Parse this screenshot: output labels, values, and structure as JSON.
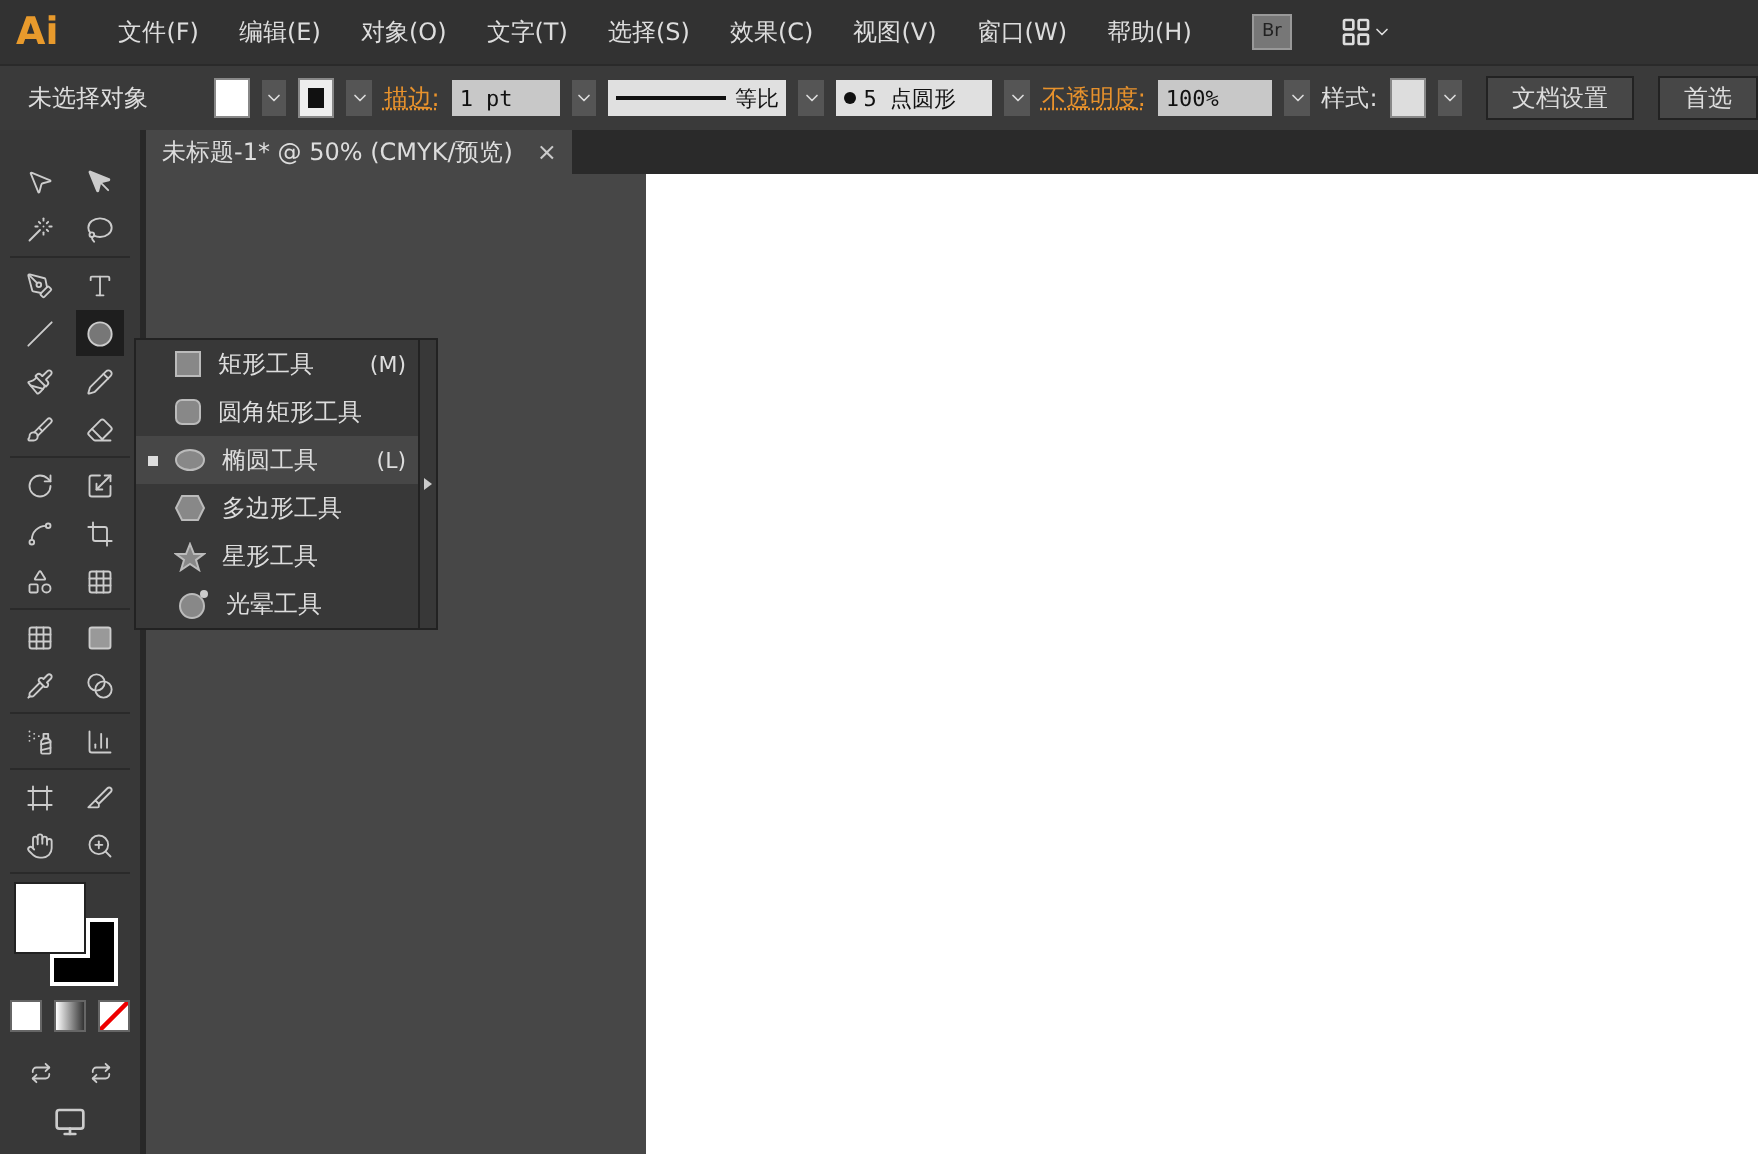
{
  "menu_bar": {
    "logo": "Ai",
    "items": [
      "文件(F)",
      "编辑(E)",
      "对象(O)",
      "文字(T)",
      "选择(S)",
      "效果(C)",
      "视图(V)",
      "窗口(W)",
      "帮助(H)"
    ],
    "bridge_button": "Br"
  },
  "control_bar": {
    "selection_label": "未选择对象",
    "stroke_label": "描边:",
    "stroke_weight": "1 pt",
    "stroke_profile": "等比",
    "brush": "5 点圆形",
    "opacity_label": "不透明度:",
    "opacity": "100%",
    "style_label": "样式:",
    "buttons": [
      "文档设置",
      "首选"
    ]
  },
  "toolbox": {
    "shape_tool_active": true
  },
  "document_tab": {
    "title": "未标题-1* @ 50% (CMYK/预览)",
    "close": "×"
  },
  "flyout": {
    "items": [
      {
        "kind": "rectangle",
        "label": "矩形工具",
        "shortcut": "(M)",
        "selected": false
      },
      {
        "kind": "rounded",
        "label": "圆角矩形工具",
        "selected": false
      },
      {
        "kind": "ellipse",
        "label": "椭圆工具",
        "shortcut": "(L)",
        "selected": true
      },
      {
        "kind": "polygon",
        "label": "多边形工具",
        "selected": false
      },
      {
        "kind": "star",
        "label": "星形工具",
        "selected": false
      },
      {
        "kind": "flare",
        "label": "光晕工具",
        "selected": false
      }
    ]
  }
}
